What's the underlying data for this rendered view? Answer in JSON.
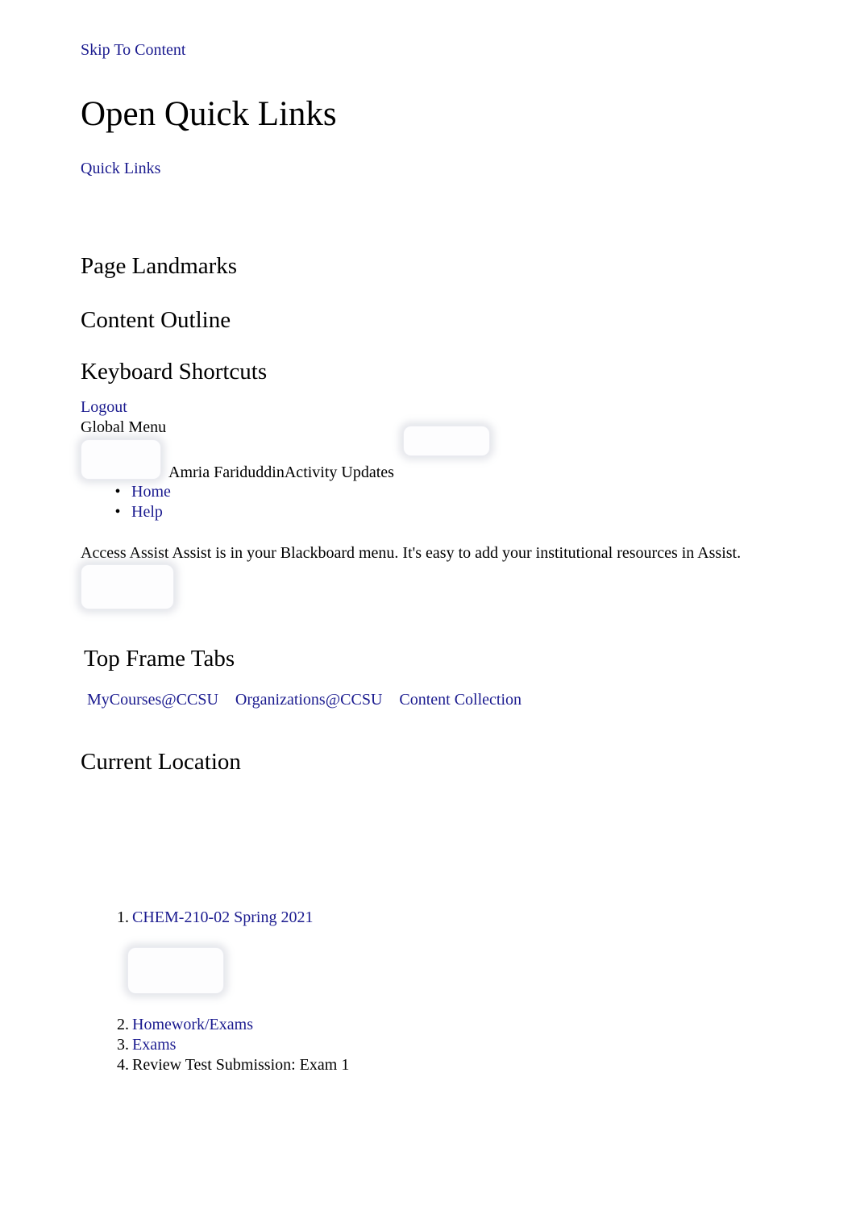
{
  "accessibility": {
    "skip_to_content": "Skip To Content"
  },
  "header": {
    "title": "Open Quick Links",
    "quick_links": "Quick Links"
  },
  "sections": {
    "page_landmarks": "Page Landmarks",
    "content_outline": "Content Outline",
    "keyboard_shortcuts": "Keyboard Shortcuts",
    "top_frame_tabs": "Top Frame Tabs",
    "current_location": "Current Location"
  },
  "global_menu": {
    "logout": "Logout",
    "label": "Global Menu",
    "user_activity": "Amria FariduddinActivity Updates",
    "items": [
      {
        "label": "Home"
      },
      {
        "label": "Help"
      }
    ]
  },
  "assist": {
    "paragraph": "Access Assist Assist is in your Blackboard menu. It's easy to add your institutional resources in Assist."
  },
  "top_frame_tabs": [
    {
      "label": "MyCourses@CCSU"
    },
    {
      "label": "Organizations@CCSU"
    },
    {
      "label": "Content Collection"
    }
  ],
  "breadcrumb": [
    {
      "num": "1.",
      "label": "CHEM-210-02 Spring 2021",
      "is_link": true
    },
    {
      "num": "2.",
      "label": "Homework/Exams",
      "is_link": true
    },
    {
      "num": "3.",
      "label": "Exams",
      "is_link": true
    },
    {
      "num": "4.",
      "label": "Review Test Submission: Exam 1",
      "is_link": false
    }
  ],
  "colors": {
    "link": "#1b1b8f",
    "text": "#000000",
    "background": "#ffffff"
  },
  "icons": {
    "bullet": "•"
  }
}
